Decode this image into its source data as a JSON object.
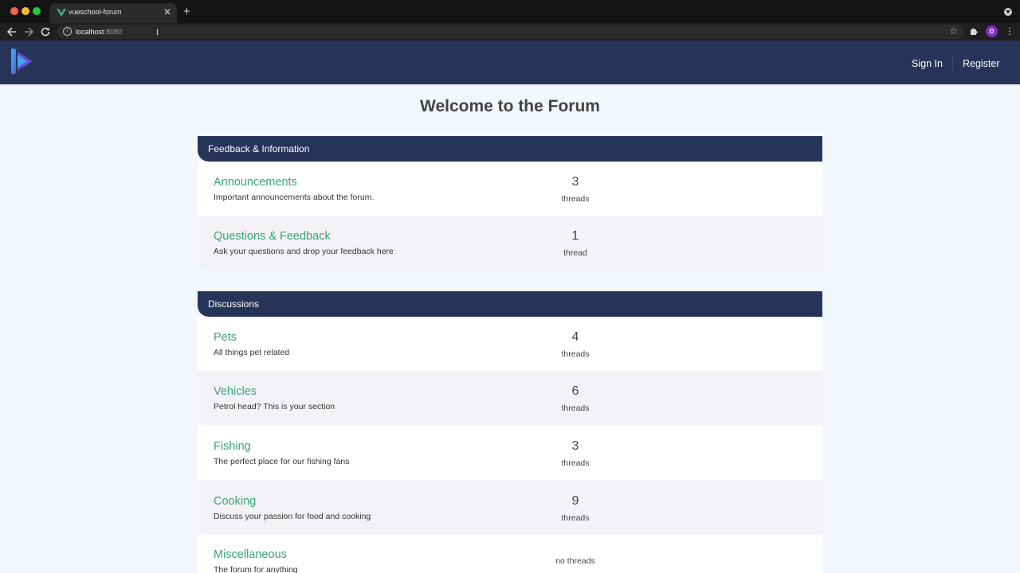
{
  "browser": {
    "tab_title": "vueschool-forum",
    "url_host": "localhost",
    "url_port": ":8080",
    "avatar_letter": "D"
  },
  "header": {
    "sign_in": "Sign In",
    "register": "Register"
  },
  "page_title": "Welcome to the Forum",
  "categories": [
    {
      "name": "Feedback & Information",
      "forums": [
        {
          "name": "Announcements",
          "description": "Important announcements about the forum.",
          "count": "3",
          "label": "threads"
        },
        {
          "name": "Questions & Feedback",
          "description": "Ask your questions and drop your feedback here",
          "count": "1",
          "label": "thread"
        }
      ]
    },
    {
      "name": "Discussions",
      "forums": [
        {
          "name": "Pets",
          "description": "All things pet related",
          "count": "4",
          "label": "threads"
        },
        {
          "name": "Vehicles",
          "description": "Petrol head? This is your section",
          "count": "6",
          "label": "threads"
        },
        {
          "name": "Fishing",
          "description": "The perfect place for our fishing fans",
          "count": "3",
          "label": "threads"
        },
        {
          "name": "Cooking",
          "description": "Discuss your passion for food and cooking",
          "count": "9",
          "label": "threads"
        },
        {
          "name": "Miscellaneous",
          "description": "The forum for anything",
          "count": "",
          "label": "no threads"
        }
      ]
    }
  ],
  "colors": {
    "header_bg": "#263459",
    "forum_link": "#3aa37c",
    "page_bg": "#f2f6fd"
  }
}
